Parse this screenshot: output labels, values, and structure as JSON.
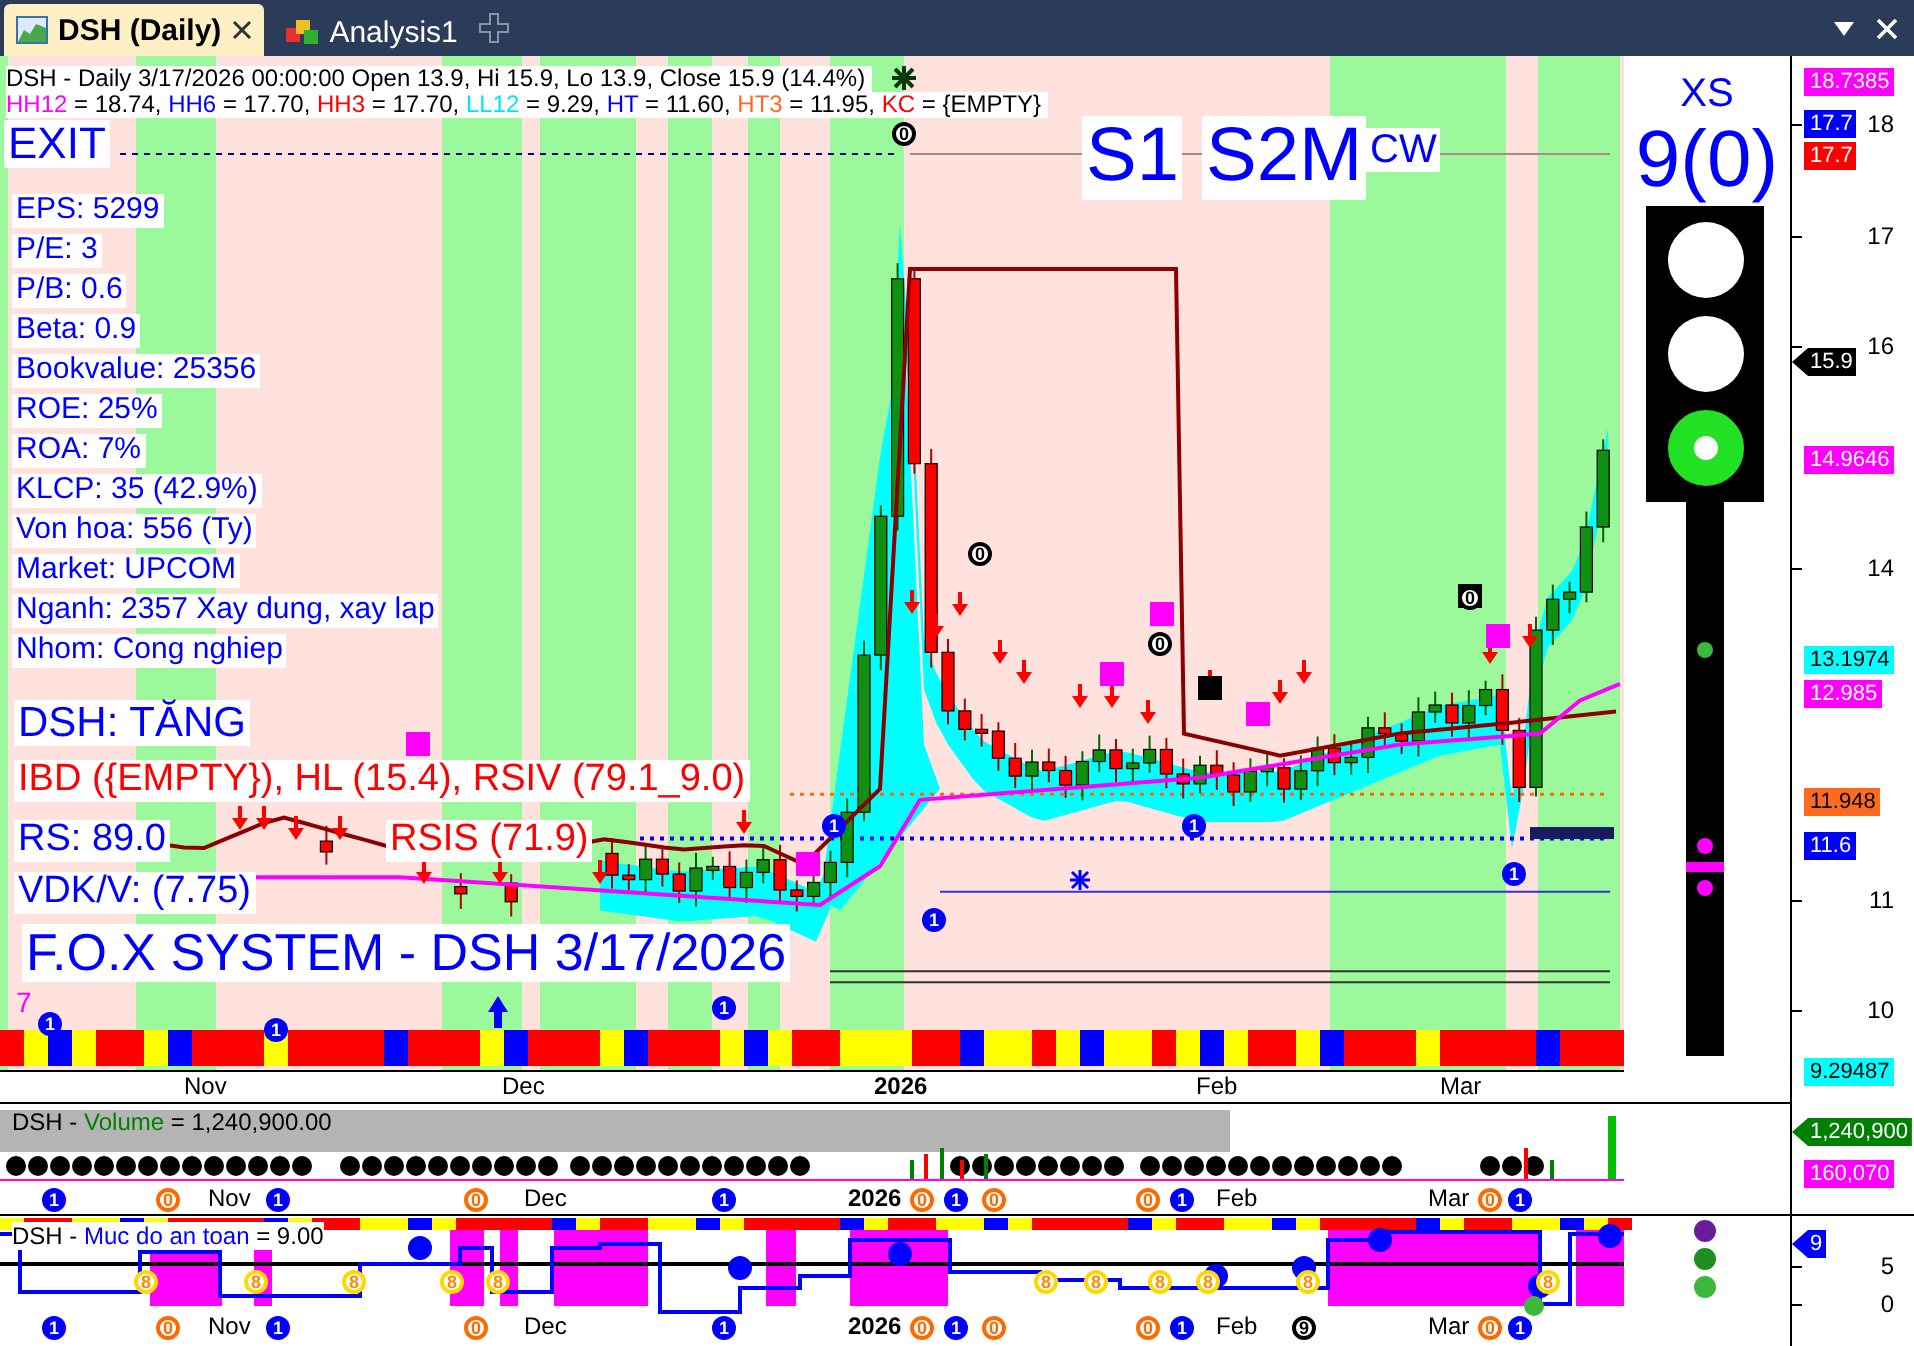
{
  "tabs": [
    {
      "label": "DSH (Daily)",
      "selected": true
    },
    {
      "label": "Analysis1",
      "selected": false
    }
  ],
  "chart": {
    "header": "DSH - Daily 3/17/2026 00:00:00 Open 13.9, Hi 15.9, Lo 13.9, Close 15.9 (14.4%)",
    "indicators": [
      {
        "name": "HH12",
        "color": "#ff00ff",
        "value": "= 18.74,"
      },
      {
        "name": "HH6",
        "color": "#0000ff",
        "value": "= 17.70,"
      },
      {
        "name": "HH3",
        "color": "#ff0000",
        "value": "= 17.70,"
      },
      {
        "name": "LL12",
        "color": "#00e5ff",
        "value": "= 9.29,"
      },
      {
        "name": "HT",
        "color": "#0000ff",
        "value": "= 11.60,"
      },
      {
        "name": "HT3",
        "color": "#ff6a21",
        "value": "= 11.95,"
      },
      {
        "name": "KC",
        "color": "#ff0000",
        "value": "= {EMPTY}"
      }
    ],
    "exit_label": "EXIT",
    "fundamentals": [
      "EPS: 5299",
      "P/E: 3",
      "P/B: 0.6",
      "Beta: 0.9",
      "Bookvalue: 25356",
      "ROE: 25%",
      "ROA: 7%",
      "KLCP: 35 (42.9%)",
      "Von hoa: 556 (Ty)",
      "Market: UPCOM",
      "Nganh: 2357 Xay dung, xay lap",
      "Nhom: Cong nghiep"
    ],
    "signals": [
      "S1",
      "S2M"
    ],
    "signal_note": "CW",
    "trend": "DSH: TĂNG",
    "ibd": "IBD ({EMPTY}), HL (15.4), RSIV (79.1_9.0)",
    "rs": "RS: 89.0",
    "rsis": "RSIS (71.9)",
    "vdk": "VDK/V:  (7.75)",
    "banner": "F.O.X SYSTEM - DSH 3/17/2026",
    "corner_mark": "7",
    "markers": [
      {
        "text": "0",
        "kind": "ring",
        "color": "#000000"
      },
      {
        "text": "0",
        "kind": "ring",
        "color": "#000000"
      },
      {
        "text": "0",
        "kind": "ring",
        "color": "#000000"
      },
      {
        "text": "0",
        "kind": "ring",
        "color": "#000000"
      },
      {
        "text": "1",
        "kind": "filled",
        "color": "#0000ff"
      },
      {
        "text": "1",
        "kind": "filled",
        "color": "#0000ff"
      },
      {
        "text": "1",
        "kind": "filled",
        "color": "#0000ff"
      },
      {
        "text": "1",
        "kind": "filled",
        "color": "#0000ff"
      },
      {
        "text": "1",
        "kind": "filled",
        "color": "#0000ff"
      },
      {
        "text": "1",
        "kind": "filled",
        "color": "#0000ff"
      },
      {
        "text": "1",
        "kind": "filled",
        "color": "#0000ff"
      }
    ]
  },
  "xs": {
    "label": "XS",
    "value": "9(0)"
  },
  "traffic_light": [
    {
      "on": false
    },
    {
      "on": false
    },
    {
      "on": true
    }
  ],
  "price_axis": {
    "ticks": [
      "18",
      "17",
      "16",
      "14",
      "11",
      "10"
    ],
    "tags": [
      {
        "text": "18.7385",
        "color": "#ff00ff",
        "kind": "box"
      },
      {
        "text": "17.7",
        "color": "#0000ff",
        "kind": "box"
      },
      {
        "text": "17.7",
        "color": "#ff0000",
        "kind": "box"
      },
      {
        "text": "15.9",
        "color": "#000000",
        "kind": "arrow"
      },
      {
        "text": "14.9646",
        "color": "#ff00ff",
        "kind": "box"
      },
      {
        "text": "13.1974",
        "color": "#00ffff",
        "kind": "box"
      },
      {
        "text": "12.985",
        "color": "#ff00ff",
        "kind": "box"
      },
      {
        "text": "11.948",
        "color": "#ff6a21",
        "kind": "box"
      },
      {
        "text": "11.6",
        "color": "#0000ff",
        "kind": "box"
      },
      {
        "text": "9.29487",
        "color": "#00ffff",
        "kind": "box"
      }
    ]
  },
  "date_axis": [
    {
      "text": "Nov",
      "kind": "month"
    },
    {
      "text": "Dec",
      "kind": "month"
    },
    {
      "text": "2026",
      "kind": "year"
    },
    {
      "text": "Feb",
      "kind": "month"
    },
    {
      "text": "Mar",
      "kind": "month"
    }
  ],
  "volume": {
    "prefix": "DSH -",
    "name": "Volume",
    "value": "= 1,240,900.00",
    "date_labels": [
      {
        "text": "Nov",
        "kind": "month"
      },
      {
        "text": "Dec",
        "kind": "month"
      },
      {
        "text": "2026",
        "kind": "year"
      },
      {
        "text": "Feb",
        "kind": "month"
      },
      {
        "text": "Mar",
        "kind": "month"
      }
    ],
    "markers": [
      {
        "text": "1",
        "kind": "filled",
        "color": "#0000ff"
      },
      {
        "text": "0",
        "kind": "ring",
        "color": "#ff6a00"
      },
      {
        "text": "1",
        "kind": "filled",
        "color": "#0000ff"
      },
      {
        "text": "0",
        "kind": "ring",
        "color": "#ff6a00"
      },
      {
        "text": "1",
        "kind": "filled",
        "color": "#0000ff"
      },
      {
        "text": "0",
        "kind": "ring",
        "color": "#ff6a00"
      },
      {
        "text": "1",
        "kind": "filled",
        "color": "#0000ff"
      },
      {
        "text": "0",
        "kind": "ring",
        "color": "#ff6a00"
      },
      {
        "text": "0",
        "kind": "ring",
        "color": "#ff6a00"
      },
      {
        "text": "1",
        "kind": "filled",
        "color": "#0000ff"
      },
      {
        "text": "0",
        "kind": "ring",
        "color": "#ff6a00"
      },
      {
        "text": "1",
        "kind": "filled",
        "color": "#0000ff"
      }
    ],
    "tags": [
      {
        "text": "1,240,900",
        "color": "#008000",
        "kind": "arrow"
      },
      {
        "text": "160,070",
        "color": "#ff00ff",
        "kind": "box"
      }
    ]
  },
  "safety": {
    "prefix": "DSH -",
    "name": "Muc do an toan",
    "value": "= 9.00",
    "date_labels": [
      {
        "text": "Nov",
        "kind": "month"
      },
      {
        "text": "Dec",
        "kind": "month"
      },
      {
        "text": "2026",
        "kind": "year"
      },
      {
        "text": "Feb",
        "kind": "month"
      },
      {
        "text": "Mar",
        "kind": "month"
      }
    ],
    "level_markers": [
      {
        "text": "8",
        "kind": "ring",
        "color": "#ffd800"
      },
      {
        "text": "8",
        "kind": "ring",
        "color": "#ffd800"
      },
      {
        "text": "8",
        "kind": "ring",
        "color": "#ffd800"
      },
      {
        "text": "8",
        "kind": "ring",
        "color": "#ffd800"
      },
      {
        "text": "8",
        "kind": "ring",
        "color": "#ffd800"
      },
      {
        "text": "8",
        "kind": "ring",
        "color": "#ffd800"
      },
      {
        "text": "8",
        "kind": "ring",
        "color": "#ffd800"
      },
      {
        "text": "8",
        "kind": "ring",
        "color": "#ffd800"
      },
      {
        "text": "8",
        "kind": "ring",
        "color": "#ffd800"
      },
      {
        "text": "8",
        "kind": "ring",
        "color": "#ffd800"
      },
      {
        "text": "8",
        "kind": "ring",
        "color": "#ffd800"
      }
    ],
    "markers": [
      {
        "text": "1",
        "kind": "filled",
        "color": "#0000ff"
      },
      {
        "text": "0",
        "kind": "ring",
        "color": "#ff6a00"
      },
      {
        "text": "1",
        "kind": "filled",
        "color": "#0000ff"
      },
      {
        "text": "0",
        "kind": "ring",
        "color": "#ff6a00"
      },
      {
        "text": "1",
        "kind": "filled",
        "color": "#0000ff"
      },
      {
        "text": "0",
        "kind": "ring",
        "color": "#ff6a00"
      },
      {
        "text": "1",
        "kind": "filled",
        "color": "#0000ff"
      },
      {
        "text": "0",
        "kind": "ring",
        "color": "#ff6a00"
      },
      {
        "text": "0",
        "kind": "ring",
        "color": "#ff6a00"
      },
      {
        "text": "1",
        "kind": "filled",
        "color": "#0000ff"
      },
      {
        "text": "9",
        "kind": "ring",
        "color": "#000000"
      },
      {
        "text": "0",
        "kind": "ring",
        "color": "#ff6a00"
      },
      {
        "text": "1",
        "kind": "filled",
        "color": "#0000ff"
      }
    ],
    "ticks": [
      "5",
      "0"
    ],
    "tags": [
      {
        "text": "9",
        "color": "#0000ff",
        "kind": "arrow"
      }
    ],
    "status_dots": [
      {
        "color": "#6a1b9a"
      },
      {
        "color": "#1e8e1e"
      },
      {
        "color": "#3cb83c"
      }
    ]
  }
}
